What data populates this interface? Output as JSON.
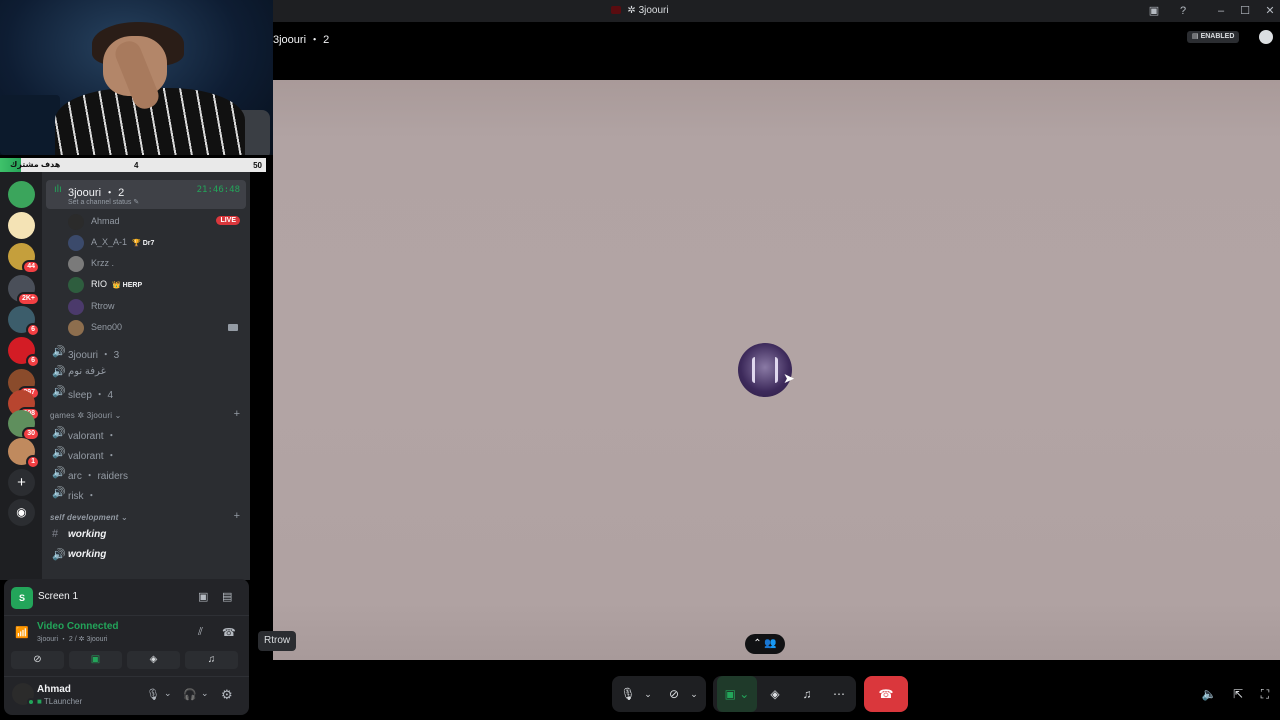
{
  "window": {
    "title": "✲ 3joouri"
  },
  "stream_overlay": {
    "goal_label": "هدف مشترك",
    "goal_current": "4",
    "goal_max": "50",
    "goal_progress": 0.08
  },
  "servers": [
    {
      "name": "server-1",
      "color": "#3ba55c",
      "badge": ""
    },
    {
      "name": "server-2",
      "color": "#f4e3b5",
      "badge": ""
    },
    {
      "name": "server-3",
      "color": "#c59f3c",
      "badge": "44"
    },
    {
      "name": "server-4",
      "color": "#4a4f59",
      "badge": "2K+"
    },
    {
      "name": "server-5",
      "color": "#3c5d6b",
      "badge": "6"
    },
    {
      "name": "server-6",
      "color": "#d31c25",
      "badge": "6"
    },
    {
      "name": "server-7",
      "color": "#8a4b2b",
      "badge": "897"
    },
    {
      "name": "server-8",
      "color": "#b8452f",
      "badge": "208"
    },
    {
      "name": "server-9",
      "color": "#5f8f5d",
      "badge": "30"
    },
    {
      "name": "server-10",
      "color": "#c08a5e",
      "badge": "1"
    }
  ],
  "active_voice": {
    "name": "3joouri",
    "count": "2",
    "time": "21:46:48",
    "status": "Set a channel status"
  },
  "voice_users": [
    {
      "name": "Ahmad",
      "tag": "",
      "live": "LIVE",
      "color": "#2b2b2b"
    },
    {
      "name": "A_X_A-1",
      "tag": "🏆 Dr7",
      "live": "",
      "color": "#3b4a6b"
    },
    {
      "name": "Krzz .",
      "tag": "",
      "live": "",
      "color": "#7a7a7a"
    },
    {
      "name": "RIO",
      "tag": "👑 HERP",
      "live": "",
      "color": "#2e5d3e"
    },
    {
      "name": "Rtrow",
      "tag": "",
      "live": "",
      "color": "#4b3a6b"
    },
    {
      "name": "Seno00",
      "tag": "",
      "live": "",
      "color": "#8d6e4e"
    }
  ],
  "channels_group1": [
    {
      "name": "3joouri ・ 3"
    },
    {
      "name": "غرفة نوم"
    },
    {
      "name": "sleep ・ 4"
    }
  ],
  "category_games": "games ✲ 3joouri",
  "channels_games": [
    {
      "name": "valorant ・"
    },
    {
      "name": "valorant ・"
    },
    {
      "name": "arc ・ raiders"
    },
    {
      "name": "risk ・"
    }
  ],
  "category_self": "self development",
  "channels_self": [
    {
      "name": "working",
      "icon": "#"
    },
    {
      "name": "working",
      "icon": "🔊"
    }
  ],
  "panel": {
    "screen_label": "Screen 1",
    "screen_icon": "S",
    "video_status": "Video Connected",
    "video_sub": "3joouri ・ 2 / ✲ 3joouri",
    "user_name": "Ahmad",
    "user_status": "TLauncher"
  },
  "stage": {
    "title": "3joouri",
    "count": "2",
    "enabled_label": "ENABLED",
    "participant_label": "Rtrow"
  }
}
